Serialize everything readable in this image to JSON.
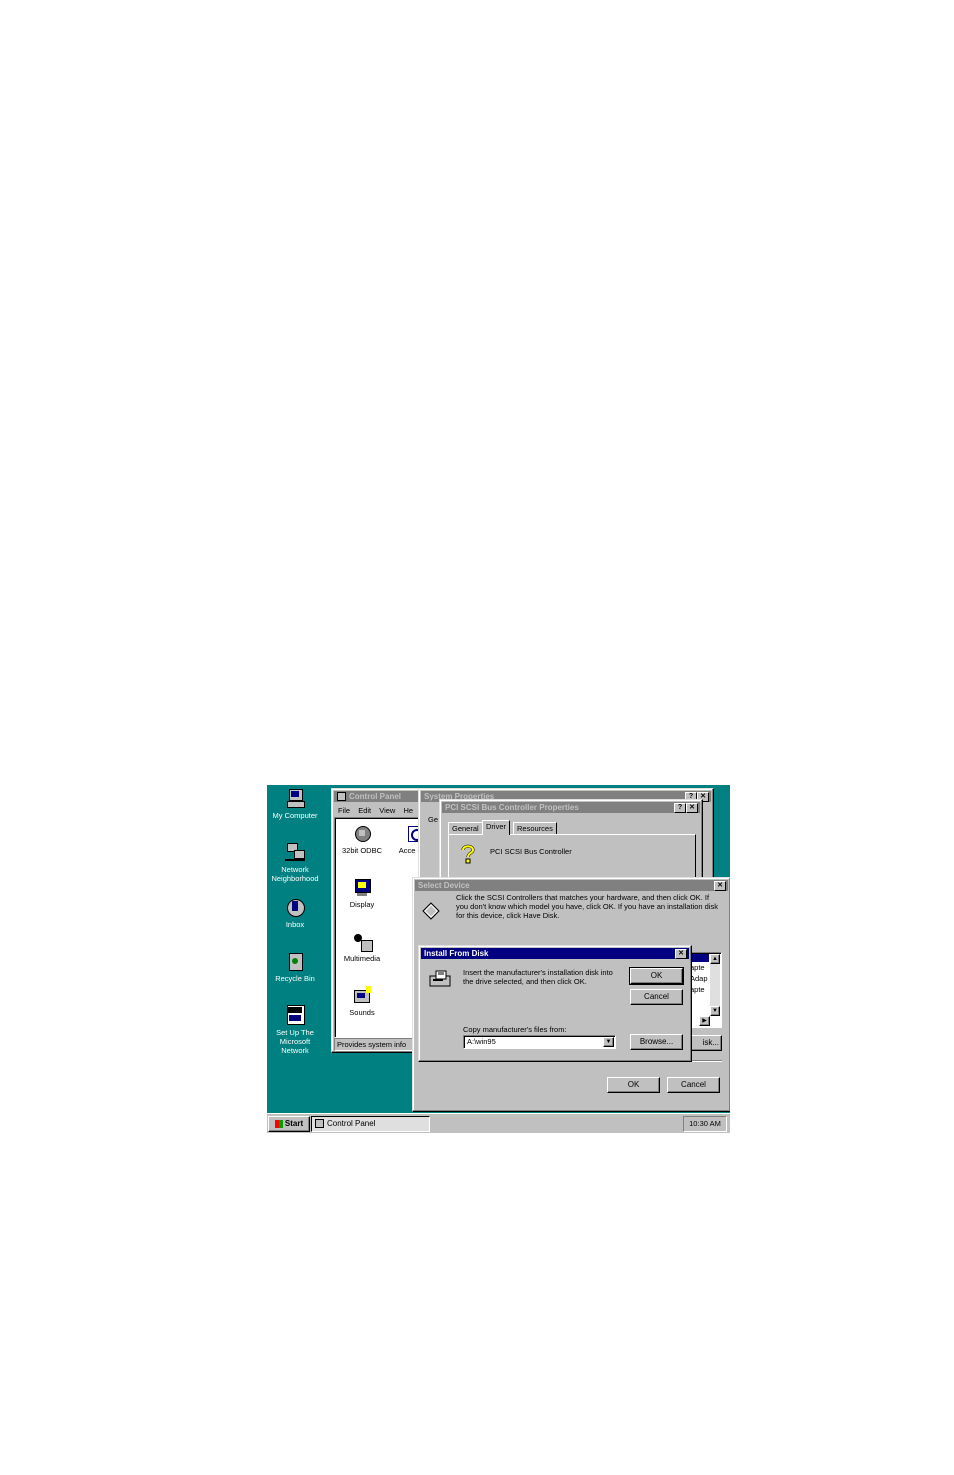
{
  "desktop": {
    "icons": [
      {
        "label": "My Computer",
        "icon": "my-computer-icon"
      },
      {
        "label": "Network Neighborhood",
        "icon": "network-neighborhood-icon"
      },
      {
        "label": "Inbox",
        "icon": "inbox-icon"
      },
      {
        "label": "Recycle Bin",
        "icon": "recycle-bin-icon"
      },
      {
        "label": "Set Up The Microsoft Network",
        "icon": "msn-icon"
      }
    ]
  },
  "control_panel": {
    "title": "Control Panel",
    "menu": [
      "File",
      "Edit",
      "View",
      "He"
    ],
    "items": [
      {
        "label": "32bit ODBC",
        "icon": "odbc-icon"
      },
      {
        "label": "Acce Opti",
        "icon": "accessibility-icon"
      },
      {
        "label": "Display",
        "icon": "display-icon"
      },
      {
        "label": "Multimedia",
        "icon": "multimedia-icon"
      },
      {
        "label": "Sounds",
        "icon": "sounds-icon"
      }
    ],
    "status": "Provides system info"
  },
  "system_properties": {
    "title": "System Properties",
    "tab_stub": "Ge"
  },
  "pci_props": {
    "title": "PCI SCSI Bus Controller Properties",
    "tabs": [
      "General",
      "Driver",
      "Resources"
    ],
    "device_name": "PCI SCSI Bus Controller"
  },
  "select_device": {
    "title": "Select Device",
    "message": "Click the SCSI Controllers that matches your hardware, and then click OK. If you don't know which model you have, click OK. If you have an installation disk for this device, click Have Disk.",
    "list_peek": [
      "apte",
      "Adap",
      "apte"
    ],
    "have_disk_peek": "isk...",
    "ok": "OK",
    "cancel": "Cancel"
  },
  "install_from_disk": {
    "title": "Install From Disk",
    "message": "Insert the manufacturer's installation disk into the drive selected, and then click OK.",
    "ok": "OK",
    "cancel": "Cancel",
    "copy_label": "Copy manufacturer's files from:",
    "path_value": "A:\\win95",
    "browse": "Browse..."
  },
  "taskbar": {
    "start": "Start",
    "task": "Control Panel",
    "clock": "10:30 AM"
  },
  "colors": {
    "desktop": "#008080",
    "title_active": "#000080",
    "title_inactive": "#808080",
    "face": "#c0c0c0"
  }
}
